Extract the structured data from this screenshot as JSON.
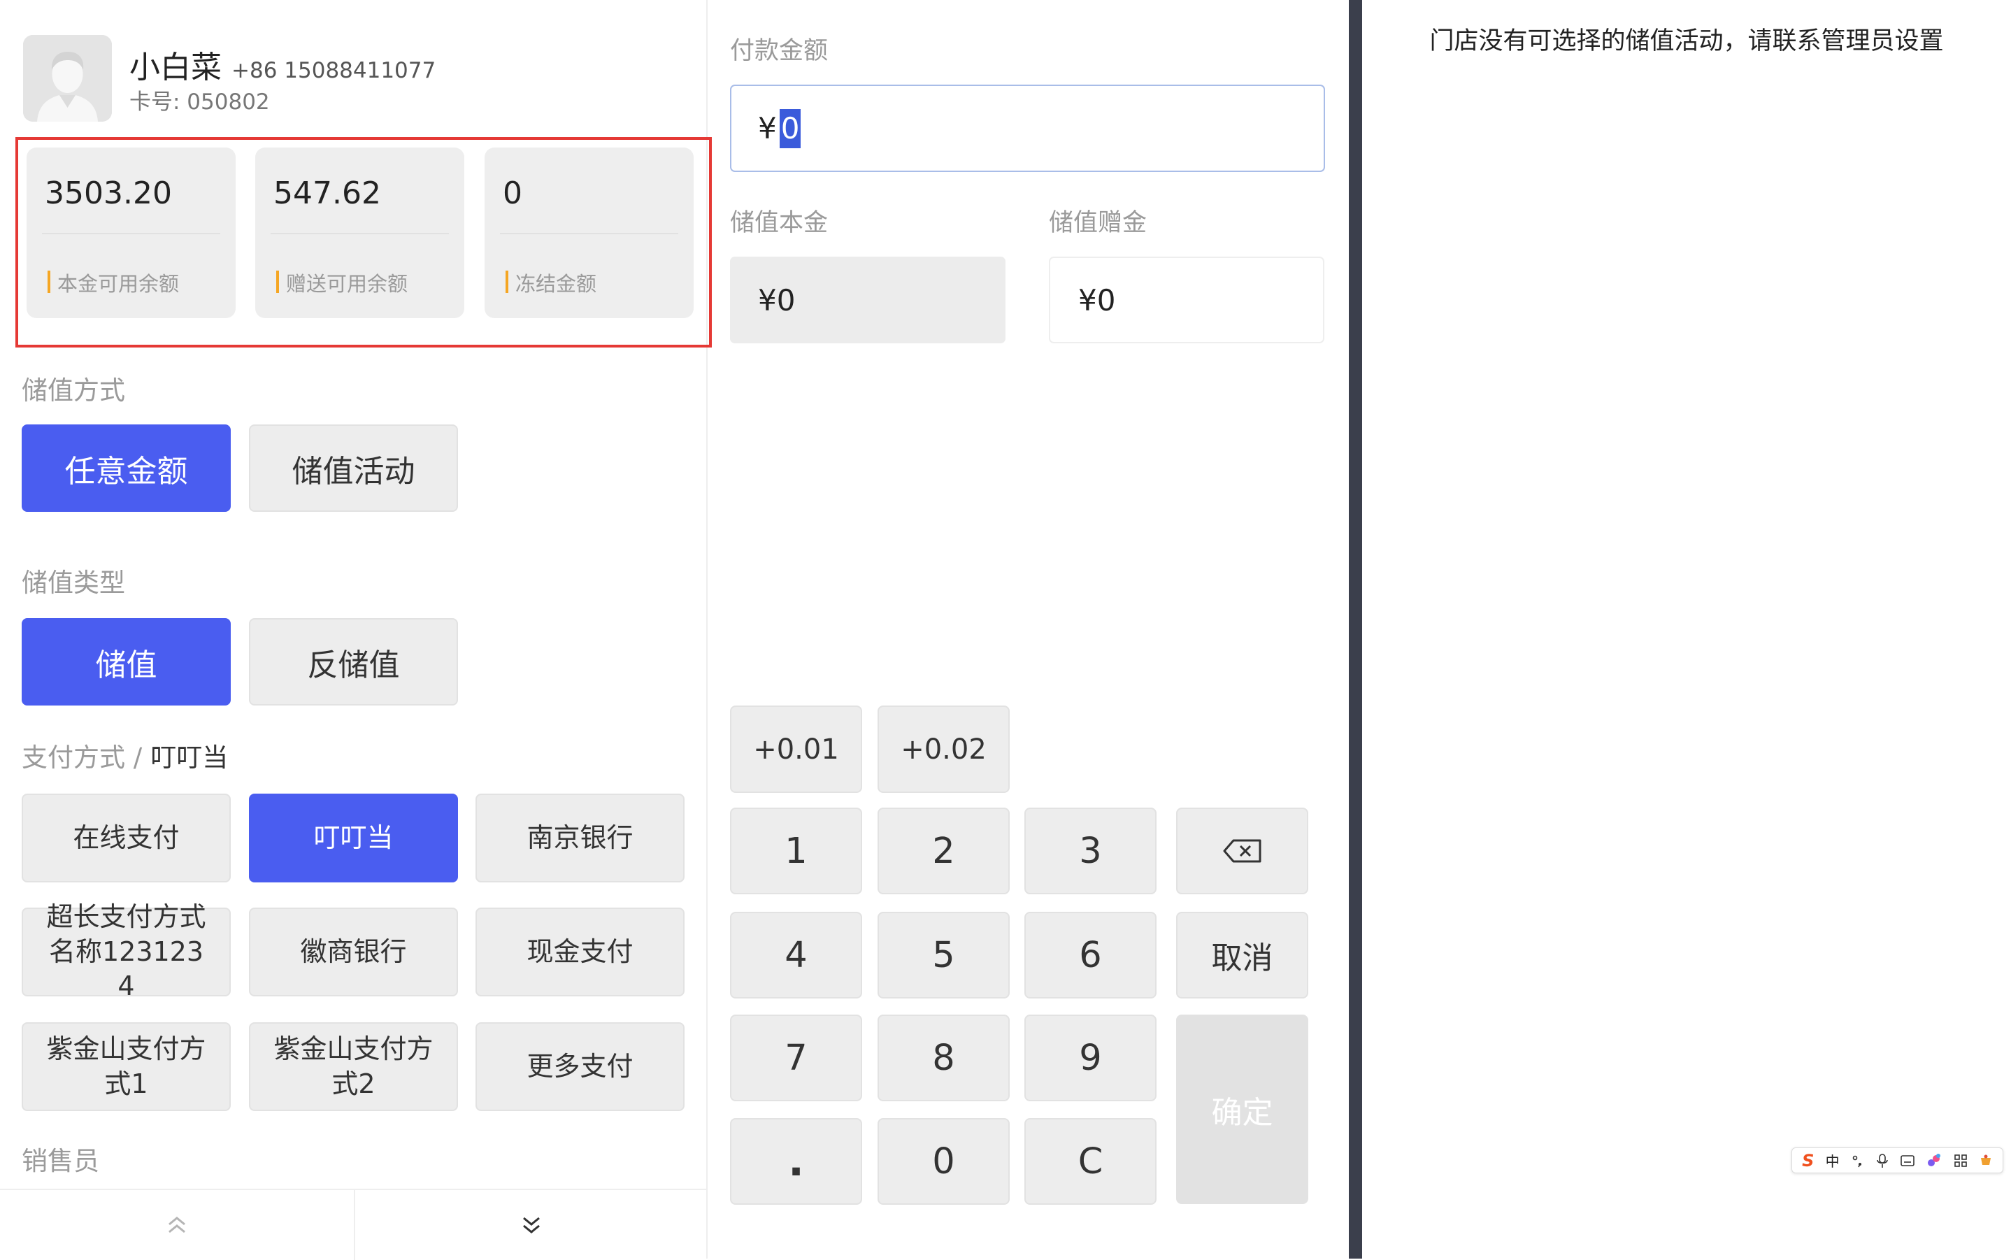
{
  "member": {
    "name": "小白菜",
    "phone": "+86 15088411077",
    "card_no": "卡号: 050802",
    "avatar_icon": "user-avatar-icon"
  },
  "balances": [
    {
      "value": "3503.20",
      "label": "本金可用余额"
    },
    {
      "value": "547.62",
      "label": "赠送可用余额"
    },
    {
      "value": "0",
      "label": "冻结金额"
    }
  ],
  "recharge_method": {
    "label": "储值方式",
    "options": [
      {
        "label": "任意金额",
        "selected": true
      },
      {
        "label": "储值活动",
        "selected": false
      }
    ]
  },
  "recharge_type": {
    "label": "储值类型",
    "options": [
      {
        "label": "储值",
        "selected": true
      },
      {
        "label": "反储值",
        "selected": false
      }
    ]
  },
  "payment": {
    "label": "支付方式 /",
    "current": "叮叮当",
    "options": [
      {
        "label": "在线支付",
        "selected": false
      },
      {
        "label": "叮叮当",
        "selected": true
      },
      {
        "label": "南京银行",
        "selected": false
      },
      {
        "label": "超长支付方式名称1231234",
        "selected": false
      },
      {
        "label": "徽商银行",
        "selected": false
      },
      {
        "label": "现金支付",
        "selected": false
      },
      {
        "label": "紫金山支付方式1",
        "selected": false
      },
      {
        "label": "紫金山支付方式2",
        "selected": false
      },
      {
        "label": "更多支付",
        "selected": false
      }
    ]
  },
  "salesperson": {
    "label": "销售员"
  },
  "footer_nav": {
    "up_icon": "double-chevron-up-icon",
    "down_icon": "double-chevron-down-icon"
  },
  "pay_amount": {
    "label": "付款金额",
    "currency": "¥",
    "value": "0"
  },
  "principal": {
    "label": "储值本金",
    "value": "¥0"
  },
  "bonus": {
    "label": "储值赠金",
    "value": "¥0"
  },
  "keypad": {
    "quick": [
      "+0.01",
      "+0.02"
    ],
    "rows": [
      [
        "1",
        "2",
        "3"
      ],
      [
        "4",
        "5",
        "6"
      ],
      [
        "7",
        "8",
        "9"
      ],
      [
        ".",
        "0",
        "C"
      ]
    ],
    "backspace_icon": "backspace-icon",
    "cancel": "取消",
    "confirm": "确定"
  },
  "notice": "门店没有可选择的储值活动，请联系管理员设置",
  "ime": {
    "logo": "S",
    "mode": "中"
  },
  "colors": {
    "primary": "#4a5df0",
    "highlight_border": "#e53935",
    "label_accent": "#f5a623",
    "divider_bar": "#3b3f4c"
  }
}
